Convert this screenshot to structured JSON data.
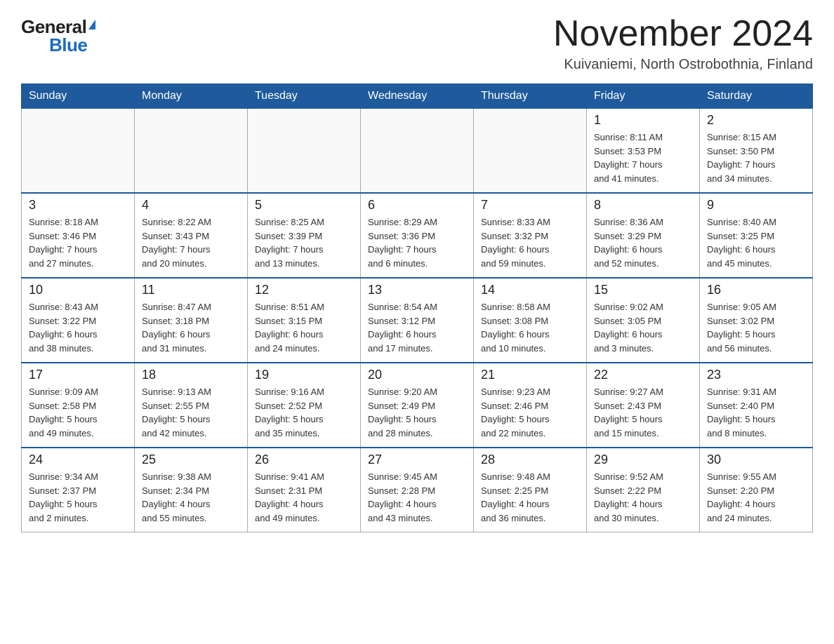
{
  "logo": {
    "general": "General",
    "blue": "Blue"
  },
  "title": "November 2024",
  "subtitle": "Kuivaniemi, North Ostrobothnia, Finland",
  "headers": [
    "Sunday",
    "Monday",
    "Tuesday",
    "Wednesday",
    "Thursday",
    "Friday",
    "Saturday"
  ],
  "weeks": [
    [
      {
        "day": "",
        "info": ""
      },
      {
        "day": "",
        "info": ""
      },
      {
        "day": "",
        "info": ""
      },
      {
        "day": "",
        "info": ""
      },
      {
        "day": "",
        "info": ""
      },
      {
        "day": "1",
        "info": "Sunrise: 8:11 AM\nSunset: 3:53 PM\nDaylight: 7 hours\nand 41 minutes."
      },
      {
        "day": "2",
        "info": "Sunrise: 8:15 AM\nSunset: 3:50 PM\nDaylight: 7 hours\nand 34 minutes."
      }
    ],
    [
      {
        "day": "3",
        "info": "Sunrise: 8:18 AM\nSunset: 3:46 PM\nDaylight: 7 hours\nand 27 minutes."
      },
      {
        "day": "4",
        "info": "Sunrise: 8:22 AM\nSunset: 3:43 PM\nDaylight: 7 hours\nand 20 minutes."
      },
      {
        "day": "5",
        "info": "Sunrise: 8:25 AM\nSunset: 3:39 PM\nDaylight: 7 hours\nand 13 minutes."
      },
      {
        "day": "6",
        "info": "Sunrise: 8:29 AM\nSunset: 3:36 PM\nDaylight: 7 hours\nand 6 minutes."
      },
      {
        "day": "7",
        "info": "Sunrise: 8:33 AM\nSunset: 3:32 PM\nDaylight: 6 hours\nand 59 minutes."
      },
      {
        "day": "8",
        "info": "Sunrise: 8:36 AM\nSunset: 3:29 PM\nDaylight: 6 hours\nand 52 minutes."
      },
      {
        "day": "9",
        "info": "Sunrise: 8:40 AM\nSunset: 3:25 PM\nDaylight: 6 hours\nand 45 minutes."
      }
    ],
    [
      {
        "day": "10",
        "info": "Sunrise: 8:43 AM\nSunset: 3:22 PM\nDaylight: 6 hours\nand 38 minutes."
      },
      {
        "day": "11",
        "info": "Sunrise: 8:47 AM\nSunset: 3:18 PM\nDaylight: 6 hours\nand 31 minutes."
      },
      {
        "day": "12",
        "info": "Sunrise: 8:51 AM\nSunset: 3:15 PM\nDaylight: 6 hours\nand 24 minutes."
      },
      {
        "day": "13",
        "info": "Sunrise: 8:54 AM\nSunset: 3:12 PM\nDaylight: 6 hours\nand 17 minutes."
      },
      {
        "day": "14",
        "info": "Sunrise: 8:58 AM\nSunset: 3:08 PM\nDaylight: 6 hours\nand 10 minutes."
      },
      {
        "day": "15",
        "info": "Sunrise: 9:02 AM\nSunset: 3:05 PM\nDaylight: 6 hours\nand 3 minutes."
      },
      {
        "day": "16",
        "info": "Sunrise: 9:05 AM\nSunset: 3:02 PM\nDaylight: 5 hours\nand 56 minutes."
      }
    ],
    [
      {
        "day": "17",
        "info": "Sunrise: 9:09 AM\nSunset: 2:58 PM\nDaylight: 5 hours\nand 49 minutes."
      },
      {
        "day": "18",
        "info": "Sunrise: 9:13 AM\nSunset: 2:55 PM\nDaylight: 5 hours\nand 42 minutes."
      },
      {
        "day": "19",
        "info": "Sunrise: 9:16 AM\nSunset: 2:52 PM\nDaylight: 5 hours\nand 35 minutes."
      },
      {
        "day": "20",
        "info": "Sunrise: 9:20 AM\nSunset: 2:49 PM\nDaylight: 5 hours\nand 28 minutes."
      },
      {
        "day": "21",
        "info": "Sunrise: 9:23 AM\nSunset: 2:46 PM\nDaylight: 5 hours\nand 22 minutes."
      },
      {
        "day": "22",
        "info": "Sunrise: 9:27 AM\nSunset: 2:43 PM\nDaylight: 5 hours\nand 15 minutes."
      },
      {
        "day": "23",
        "info": "Sunrise: 9:31 AM\nSunset: 2:40 PM\nDaylight: 5 hours\nand 8 minutes."
      }
    ],
    [
      {
        "day": "24",
        "info": "Sunrise: 9:34 AM\nSunset: 2:37 PM\nDaylight: 5 hours\nand 2 minutes."
      },
      {
        "day": "25",
        "info": "Sunrise: 9:38 AM\nSunset: 2:34 PM\nDaylight: 4 hours\nand 55 minutes."
      },
      {
        "day": "26",
        "info": "Sunrise: 9:41 AM\nSunset: 2:31 PM\nDaylight: 4 hours\nand 49 minutes."
      },
      {
        "day": "27",
        "info": "Sunrise: 9:45 AM\nSunset: 2:28 PM\nDaylight: 4 hours\nand 43 minutes."
      },
      {
        "day": "28",
        "info": "Sunrise: 9:48 AM\nSunset: 2:25 PM\nDaylight: 4 hours\nand 36 minutes."
      },
      {
        "day": "29",
        "info": "Sunrise: 9:52 AM\nSunset: 2:22 PM\nDaylight: 4 hours\nand 30 minutes."
      },
      {
        "day": "30",
        "info": "Sunrise: 9:55 AM\nSunset: 2:20 PM\nDaylight: 4 hours\nand 24 minutes."
      }
    ]
  ]
}
